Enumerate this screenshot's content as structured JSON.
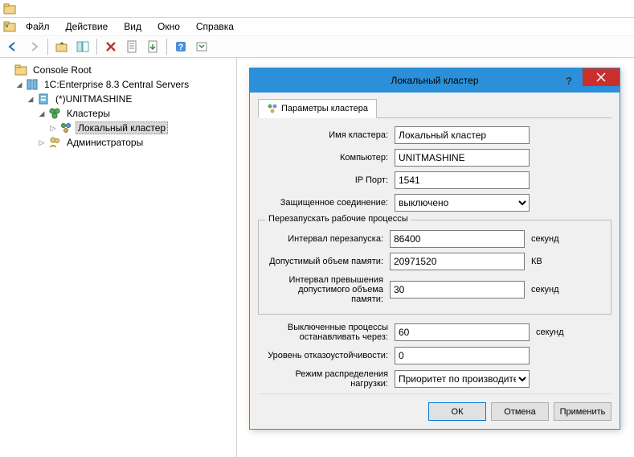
{
  "menu": {
    "file": "Файл",
    "action": "Действие",
    "view": "Вид",
    "window": "Окно",
    "help": "Справка"
  },
  "tree": {
    "root": "Console Root",
    "central_servers": "1C:Enterprise 8.3 Central Servers",
    "server_name": "(*)UNITMASHINE",
    "clusters": "Кластеры",
    "local_cluster": "Локальный кластер",
    "administrators": "Администраторы"
  },
  "dialog": {
    "title": "Локальный кластер",
    "tab_params": "Параметры кластера",
    "labels": {
      "cluster_name": "Имя кластера:",
      "computer": "Компьютер:",
      "ip_port": "IP Порт:",
      "secure_conn": "Защищенное соединение:",
      "restart_legend": "Перезапускать рабочие процессы",
      "restart_interval": "Интервал перезапуска:",
      "allowed_memory": "Допустимый объем памяти:",
      "exceed_interval": "Интервал превышения допустимого объема памяти:",
      "stop_processes": "Выключенные процессы останавливать через:",
      "fault_tolerance": "Уровень отказоустойчивости:",
      "load_distribution": "Режим распределения нагрузки:"
    },
    "values": {
      "cluster_name": "Локальный кластер",
      "computer": "UNITMASHINE",
      "ip_port": "1541",
      "secure_conn": "выключено",
      "restart_interval": "86400",
      "allowed_memory": "20971520",
      "exceed_interval": "30",
      "stop_processes": "60",
      "fault_tolerance": "0",
      "load_distribution": "Приоритет по производительн"
    },
    "units": {
      "seconds": "секунд",
      "kb": "КВ"
    },
    "buttons": {
      "ok": "ОК",
      "cancel": "Отмена",
      "apply": "Применить"
    }
  }
}
